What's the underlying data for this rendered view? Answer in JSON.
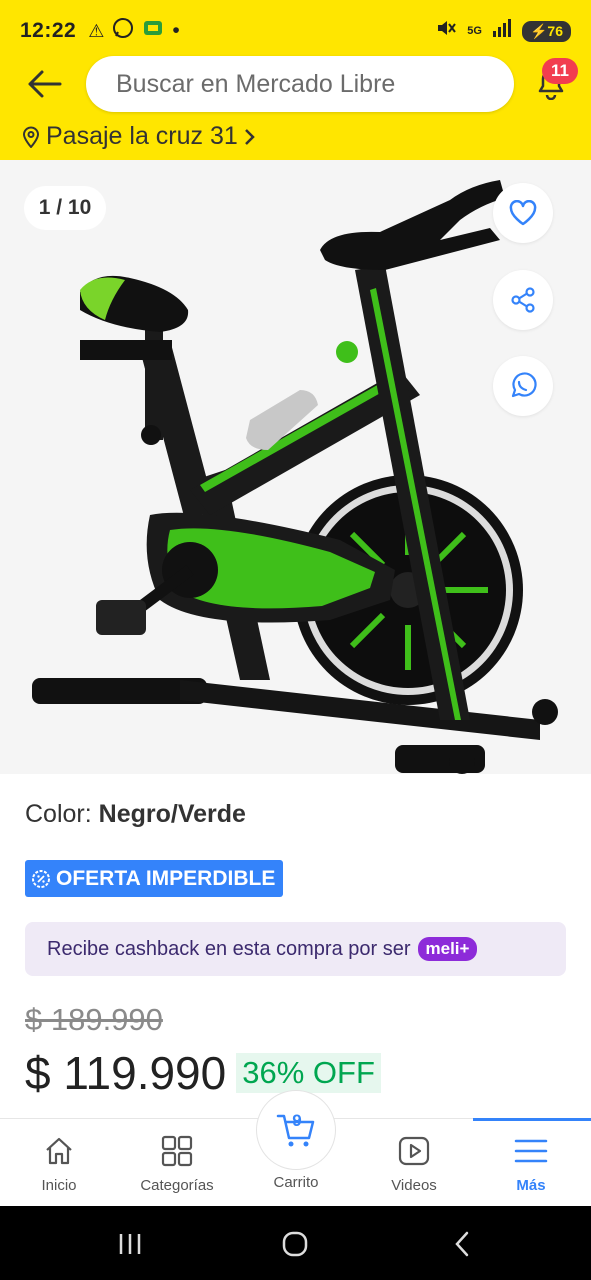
{
  "status_bar": {
    "time": "12:22",
    "battery": "76",
    "network": "5G"
  },
  "header": {
    "search_placeholder": "Buscar en Mercado Libre",
    "notification_count": "11",
    "address": "Pasaje la cruz 31",
    "colors": {
      "brand_yellow": "#ffe600",
      "badge_red": "#f23d4f"
    }
  },
  "gallery": {
    "counter": "1 / 10",
    "action_icons": [
      "heart-icon",
      "share-icon",
      "whatsapp-icon"
    ]
  },
  "product": {
    "color_label": "Color:",
    "color_value": "Negro/Verde",
    "deal_badge": "OFERTA IMPERDIBLE",
    "cashback_text": "Recibe cashback en esta compra por ser",
    "meli_plus": "meli+",
    "old_price": "$ 189.990",
    "price": "$ 119.990",
    "discount": "36% OFF",
    "colors": {
      "accent_blue": "#3483fa",
      "discount_green": "#00a650"
    }
  },
  "bottom_nav": {
    "items": [
      {
        "label": "Inicio",
        "icon": "home-icon"
      },
      {
        "label": "Categorías",
        "icon": "grid-icon"
      },
      {
        "label": "Carrito",
        "icon": "cart-icon",
        "count": "9"
      },
      {
        "label": "Videos",
        "icon": "play-icon"
      },
      {
        "label": "Más",
        "icon": "menu-icon",
        "active": true
      }
    ]
  }
}
